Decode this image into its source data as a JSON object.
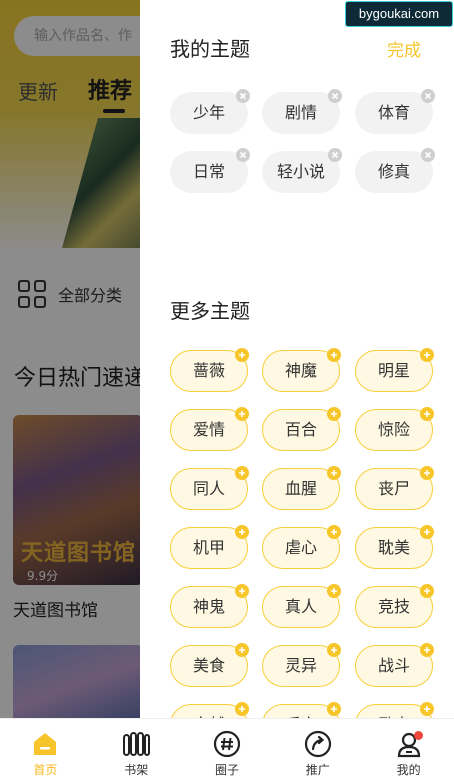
{
  "background": {
    "search": {
      "placeholder": "输入作品名、作"
    },
    "tabs": [
      {
        "label": "更新"
      },
      {
        "label": "推荐"
      }
    ],
    "all_category": "全部分类",
    "section_title": "今日热门速递",
    "comics": [
      {
        "name": "天道图书馆",
        "score": "9.9分",
        "cover_art_text": "天道图书馆"
      }
    ]
  },
  "panel": {
    "my_topics": {
      "title": "我的主题",
      "done_label": "完成",
      "items": [
        "少年",
        "剧情",
        "体育",
        "日常",
        "轻小说",
        "修真"
      ]
    },
    "more_topics": {
      "title": "更多主题",
      "items": [
        "蔷薇",
        "神魔",
        "明星",
        "爱情",
        "百合",
        "惊险",
        "同人",
        "血腥",
        "丧尸",
        "机甲",
        "虐心",
        "耽美",
        "神鬼",
        "真人",
        "竞技",
        "美食",
        "灵异",
        "战斗",
        "穿越",
        "后宫",
        "励志"
      ]
    }
  },
  "watermark": "bygoukai.com",
  "bottom_nav": {
    "items": [
      {
        "label": "首页",
        "icon": "home-icon",
        "active": true
      },
      {
        "label": "书架",
        "icon": "bookshelf-icon",
        "active": false
      },
      {
        "label": "圈子",
        "icon": "circle-hash-icon",
        "active": false
      },
      {
        "label": "推广",
        "icon": "share-arrow-icon",
        "active": false
      },
      {
        "label": "我的",
        "icon": "user-icon",
        "active": false,
        "has_red_dot": true
      }
    ]
  },
  "colors": {
    "accent": "#f7c52b",
    "chip_more_bg": "#fff9e3",
    "chip_mine_bg": "#f2f2f2",
    "red_dot": "#f0463c"
  }
}
